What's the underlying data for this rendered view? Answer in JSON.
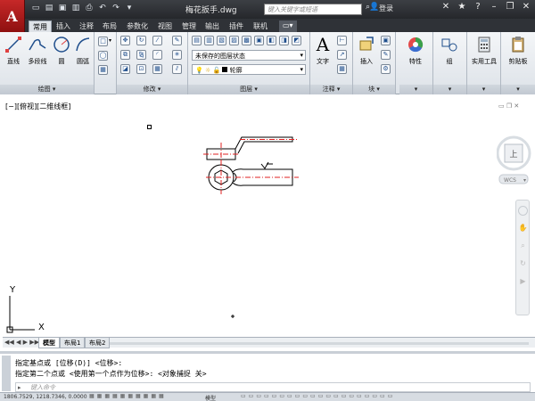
{
  "titlebar": {
    "title": "梅花扳手.dwg",
    "search_placeholder": "键入关键字或短语",
    "login_label": "登录",
    "colors": {
      "bar": "#2b2e33",
      "app_button": "#b71c1c"
    }
  },
  "ribbon_tabs": [
    {
      "label": "常用",
      "active": true
    },
    {
      "label": "插入"
    },
    {
      "label": "注释"
    },
    {
      "label": "布局"
    },
    {
      "label": "参数化"
    },
    {
      "label": "视图"
    },
    {
      "label": "管理"
    },
    {
      "label": "输出"
    },
    {
      "label": "插件"
    },
    {
      "label": "联机"
    }
  ],
  "panels": {
    "draw": {
      "title": "绘图",
      "buttons": [
        "直线",
        "多段线",
        "圆",
        "圆弧"
      ]
    },
    "modify": {
      "title": "修改"
    },
    "layers": {
      "title": "图层",
      "state_combo": "未保存的图层状态",
      "layer_combo": "轮廓"
    },
    "annotation": {
      "title": "注释",
      "text_button": "文字"
    },
    "block": {
      "title": "块",
      "insert_button": "插入"
    },
    "properties_button": "特性",
    "group_button": "组",
    "utilities_button": "实用工具",
    "clipboard_button": "剪贴板"
  },
  "viewport": {
    "label": "[−][俯视][二维线框]",
    "navcube_face": "上",
    "wcs_label": "WCS",
    "axis_x": "X",
    "axis_y": "Y"
  },
  "layout_tabs": [
    {
      "label": "模型",
      "active": true
    },
    {
      "label": "布局1"
    },
    {
      "label": "布局2"
    }
  ],
  "command": {
    "line1": "指定基点或 [位移(D)] <位移>:",
    "line2": "指定第二个点或 <使用第一个点作为位移>: <对象捕捉 关>",
    "input_placeholder": "键入命令"
  },
  "statusbar": {
    "coords": "1806.7529, 1218.7346, 0.0000",
    "model_label": "模型"
  }
}
